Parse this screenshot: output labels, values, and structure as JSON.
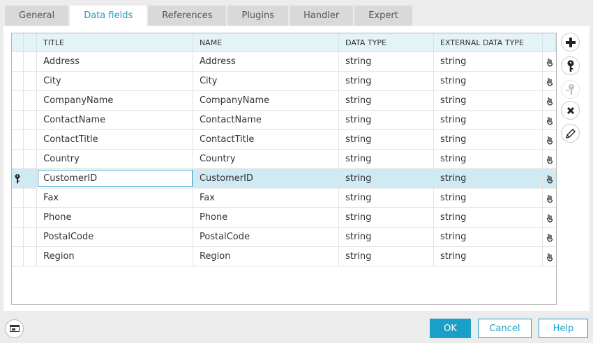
{
  "tabs": [
    "General",
    "Data fields",
    "References",
    "Plugins",
    "Handler",
    "Expert"
  ],
  "active_tab": "Data fields",
  "columns": {
    "title": "TITLE",
    "name": "NAME",
    "data_type": "DATA TYPE",
    "external_data_type": "EXTERNAL DATA TYPE"
  },
  "rows": [
    {
      "title": "Address",
      "name": "Address",
      "data_type": "string",
      "external_data_type": "string",
      "key": false
    },
    {
      "title": "City",
      "name": "City",
      "data_type": "string",
      "external_data_type": "string",
      "key": false
    },
    {
      "title": "CompanyName",
      "name": "CompanyName",
      "data_type": "string",
      "external_data_type": "string",
      "key": false
    },
    {
      "title": "ContactName",
      "name": "ContactName",
      "data_type": "string",
      "external_data_type": "string",
      "key": false
    },
    {
      "title": "ContactTitle",
      "name": "ContactTitle",
      "data_type": "string",
      "external_data_type": "string",
      "key": false
    },
    {
      "title": "Country",
      "name": "Country",
      "data_type": "string",
      "external_data_type": "string",
      "key": false
    },
    {
      "title": "CustomerID",
      "name": "CustomerID",
      "data_type": "string",
      "external_data_type": "string",
      "key": true
    },
    {
      "title": "Fax",
      "name": "Fax",
      "data_type": "string",
      "external_data_type": "string",
      "key": false
    },
    {
      "title": "Phone",
      "name": "Phone",
      "data_type": "string",
      "external_data_type": "string",
      "key": false
    },
    {
      "title": "PostalCode",
      "name": "PostalCode",
      "data_type": "string",
      "external_data_type": "string",
      "key": false
    },
    {
      "title": "Region",
      "name": "Region",
      "data_type": "string",
      "external_data_type": "string",
      "key": false
    }
  ],
  "selected_row": 6,
  "side_buttons": [
    {
      "icon": "plus-icon",
      "disabled": false
    },
    {
      "icon": "key-icon",
      "disabled": false
    },
    {
      "icon": "remove-key-icon",
      "disabled": true
    },
    {
      "icon": "close-icon",
      "disabled": false
    },
    {
      "icon": "pencil-icon",
      "disabled": false
    }
  ],
  "buttons": {
    "ok": "OK",
    "cancel": "Cancel",
    "help": "Help"
  },
  "accent_color": "#1a9fc6"
}
